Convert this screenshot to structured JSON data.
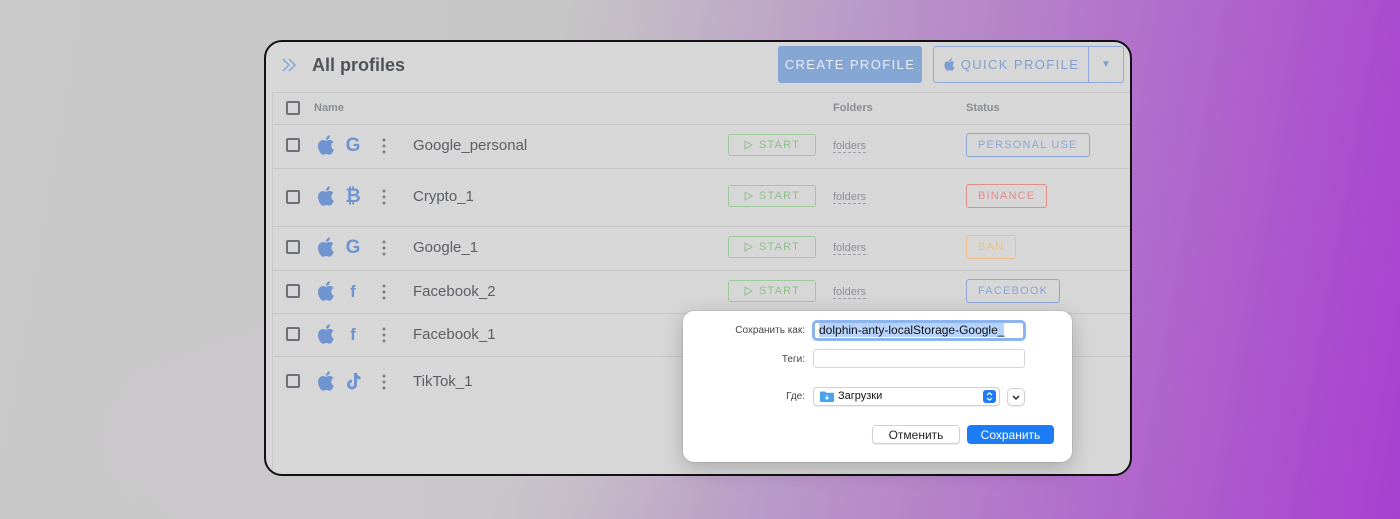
{
  "header": {
    "title": "All profiles",
    "create_label": "CREATE PROFILE",
    "quick_label": "QUICK PROFILE"
  },
  "table": {
    "columns": {
      "name": "Name",
      "folders": "Folders",
      "status": "Status"
    },
    "rows": [
      {
        "name": "Google_personal",
        "os_icon": "apple-icon",
        "site_icon": "google-icon",
        "start": "START",
        "folders": "folders",
        "status": "PERSONAL USE",
        "status_color": "#8aa7d6"
      },
      {
        "name": "Crypto_1",
        "os_icon": "apple-icon",
        "site_icon": "bitcoin-icon",
        "start": "START",
        "folders": "folders",
        "status": "BINANCE",
        "status_color": "#e28c8c"
      },
      {
        "name": "Google_1",
        "os_icon": "apple-icon",
        "site_icon": "google-icon",
        "start": "START",
        "folders": "folders",
        "status": "BAN",
        "status_color": "#f0bd84"
      },
      {
        "name": "Facebook_2",
        "os_icon": "apple-icon",
        "site_icon": "facebook-icon",
        "start": "START",
        "folders": "folders",
        "status": "FACEBOOK",
        "status_color": "#8aa7d6"
      },
      {
        "name": "Facebook_1",
        "os_icon": "apple-icon",
        "site_icon": "facebook-icon"
      },
      {
        "name": "TikTok_1",
        "os_icon": "apple-icon",
        "site_icon": "tiktok-icon"
      }
    ]
  },
  "save_dialog": {
    "save_as_label": "Сохранить как:",
    "save_as_value": "dolphin-anty-localStorage-Google_",
    "tags_label": "Теги:",
    "tags_value": "",
    "where_label": "Где:",
    "where_value": "Загрузки",
    "cancel_label": "Отменить",
    "save_label": "Сохранить",
    "accent_color": "#1b7cf4"
  }
}
